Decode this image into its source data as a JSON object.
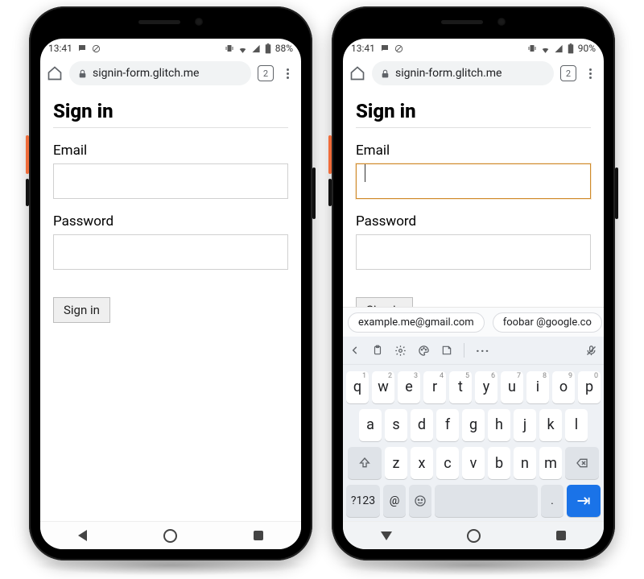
{
  "left": {
    "status": {
      "time": "13:41",
      "battery": "88%"
    },
    "url": "signin-form.glitch.me",
    "tab_count": "2",
    "page": {
      "title": "Sign in",
      "email_label": "Email",
      "password_label": "Password",
      "submit_label": "Sign in"
    }
  },
  "right": {
    "status": {
      "time": "13:41",
      "battery": "90%"
    },
    "url": "signin-form.glitch.me",
    "tab_count": "2",
    "page": {
      "title": "Sign in",
      "email_label": "Email",
      "email_value": "",
      "password_label": "Password",
      "submit_label": "Sign in"
    },
    "suggestions": [
      "example.me@gmail.com",
      "foobar @google.co"
    ],
    "keyboard": {
      "row1": [
        {
          "k": "q",
          "h": "1"
        },
        {
          "k": "w",
          "h": "2"
        },
        {
          "k": "e",
          "h": "3"
        },
        {
          "k": "r",
          "h": "4"
        },
        {
          "k": "t",
          "h": "5"
        },
        {
          "k": "y",
          "h": "6"
        },
        {
          "k": "u",
          "h": "7"
        },
        {
          "k": "i",
          "h": "8"
        },
        {
          "k": "o",
          "h": "9"
        },
        {
          "k": "p",
          "h": "0"
        }
      ],
      "row2": [
        "a",
        "s",
        "d",
        "f",
        "g",
        "h",
        "j",
        "k",
        "l"
      ],
      "row3": [
        "z",
        "x",
        "c",
        "v",
        "b",
        "n",
        "m"
      ],
      "sym_label": "?123",
      "at_label": "@",
      "period_label": "."
    }
  }
}
